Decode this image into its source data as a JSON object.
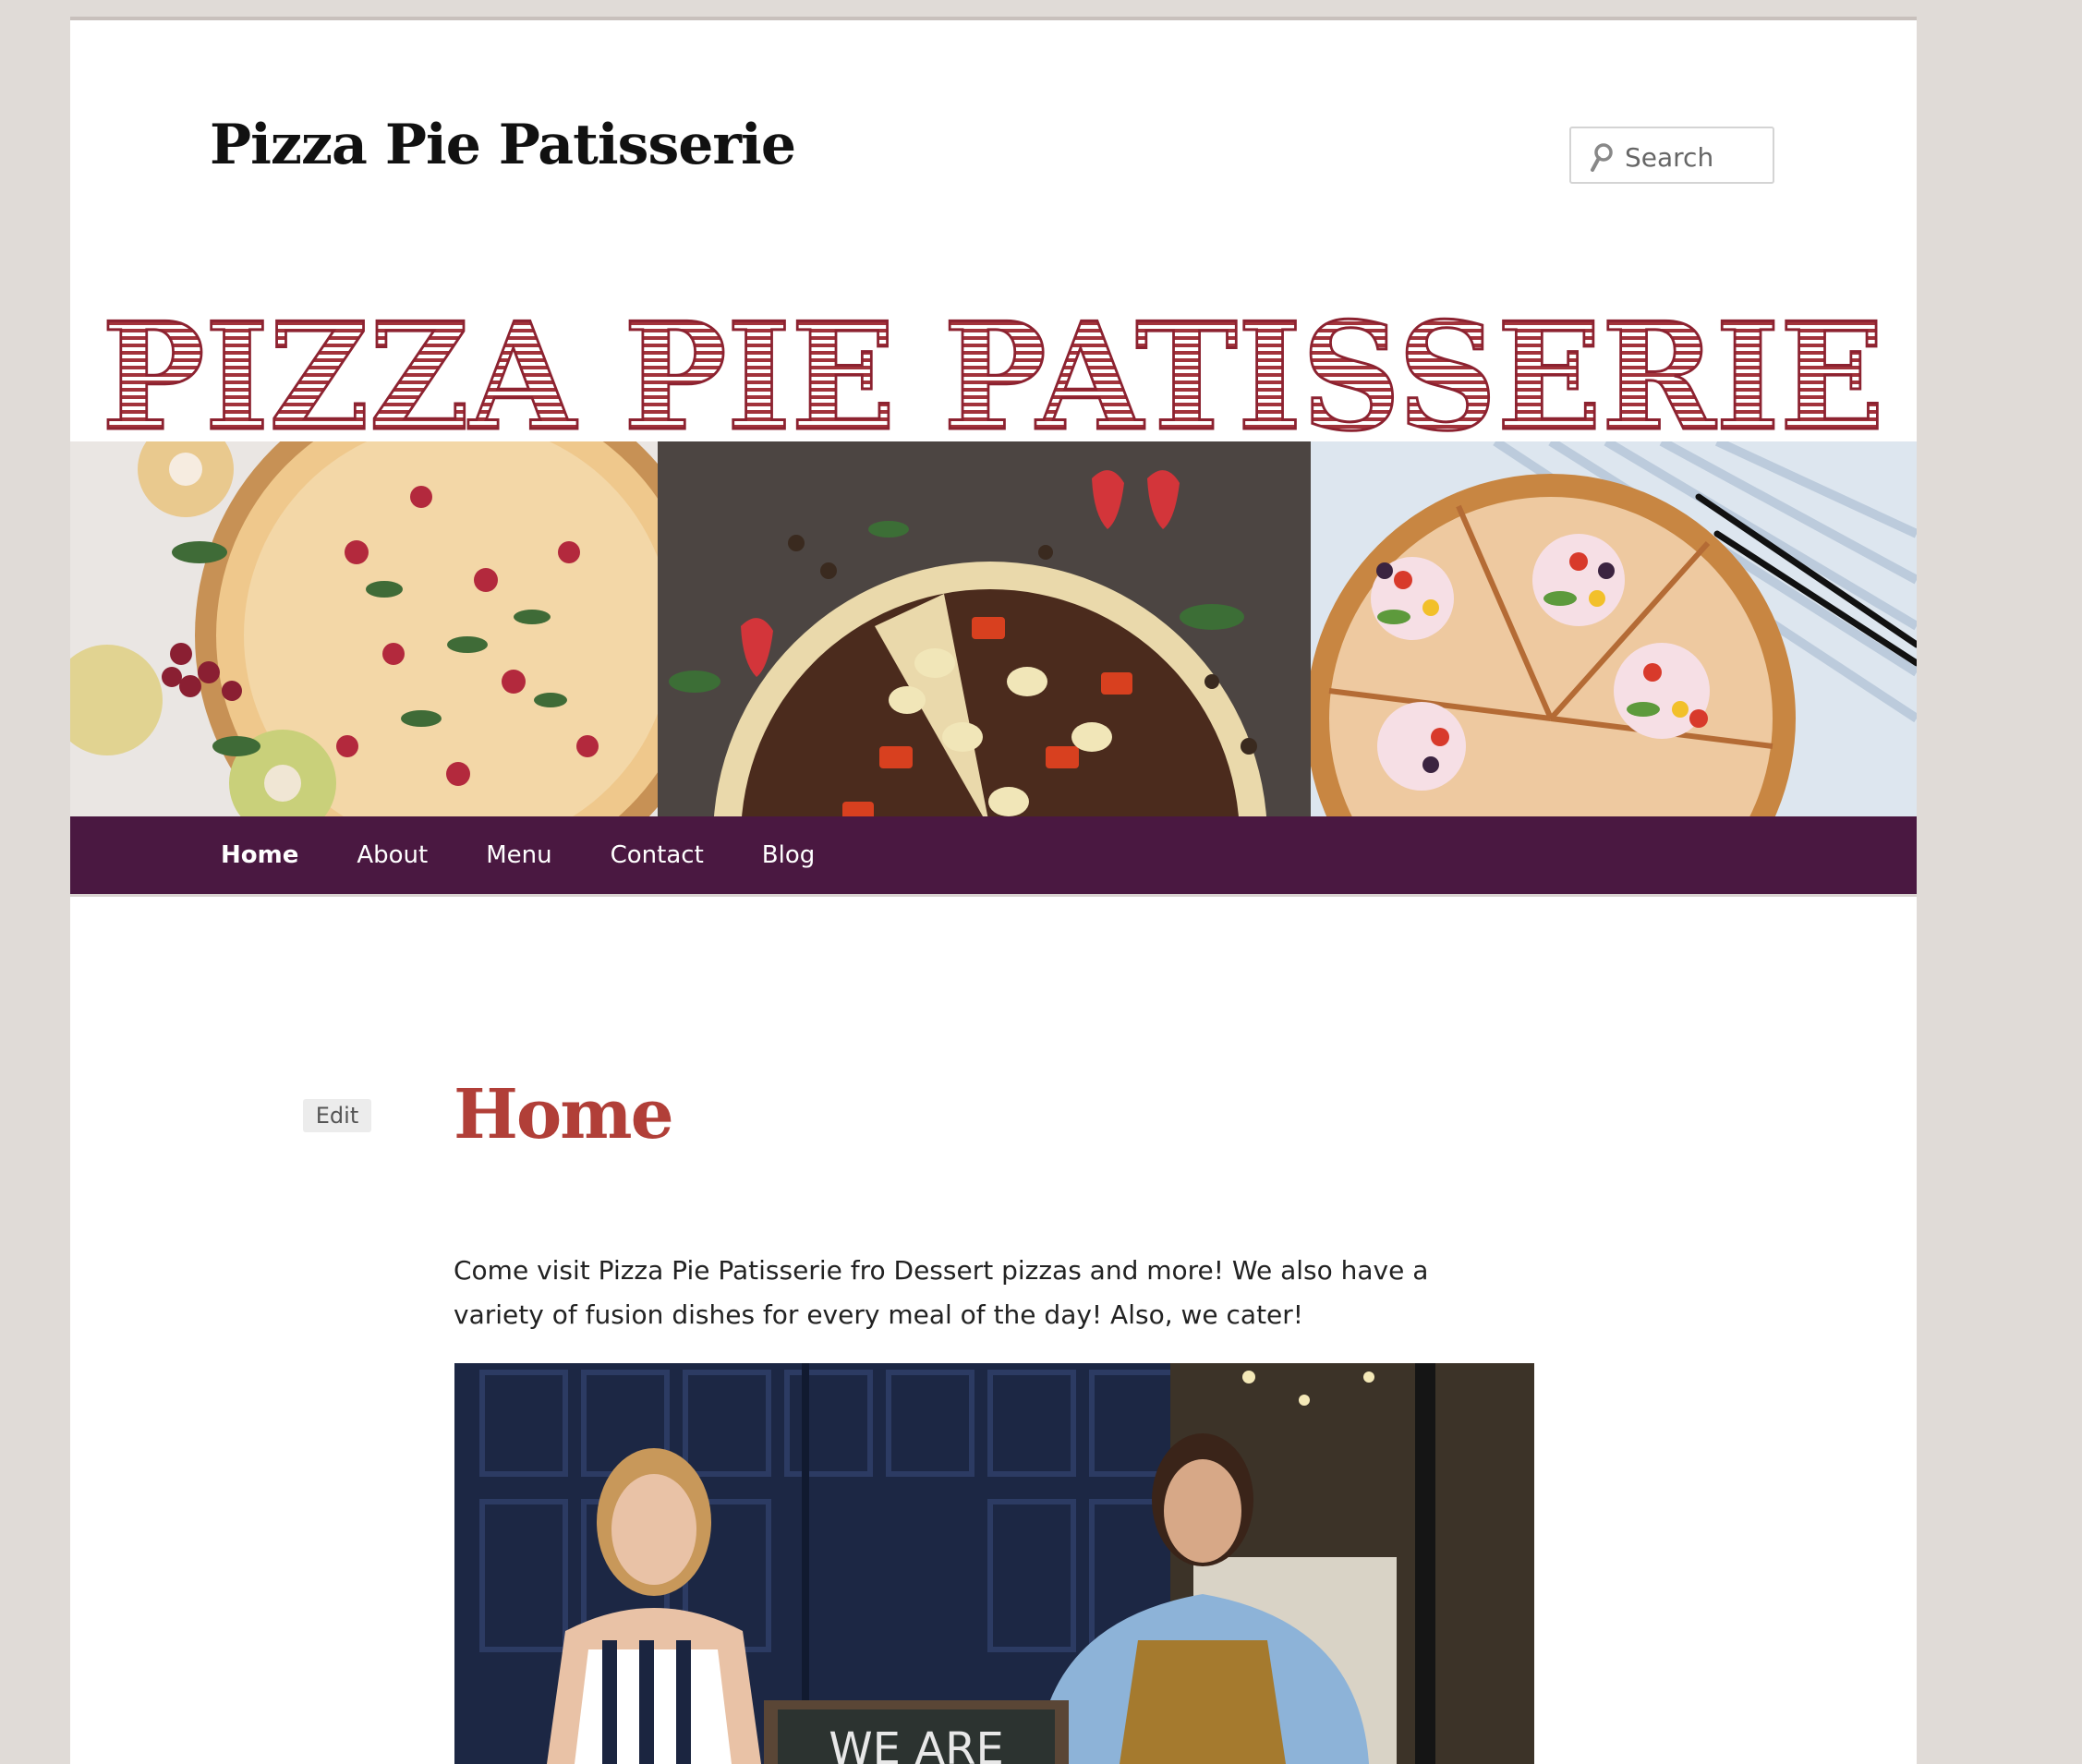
{
  "site": {
    "title": "Pizza Pie Patisserie",
    "banner_text": "PIZZA PIE PATISSERIE",
    "banner_color": "#a2333b"
  },
  "search": {
    "placeholder": "Search",
    "icon": "search-icon"
  },
  "nav": {
    "background": "#4a1841",
    "items": [
      {
        "label": "Home",
        "current": true
      },
      {
        "label": "About",
        "current": false
      },
      {
        "label": "Menu",
        "current": false
      },
      {
        "label": "Contact",
        "current": false
      },
      {
        "label": "Blog",
        "current": false
      }
    ]
  },
  "entry": {
    "edit_label": "Edit",
    "title": "Home",
    "title_color": "#b13f38",
    "text": "Come visit Pizza Pie Patisserie fro Dessert pizzas and more! We also have a variety of fusion dishes for every meal of the day! Also, we cater!",
    "chalkboard_text": "WE ARE"
  }
}
